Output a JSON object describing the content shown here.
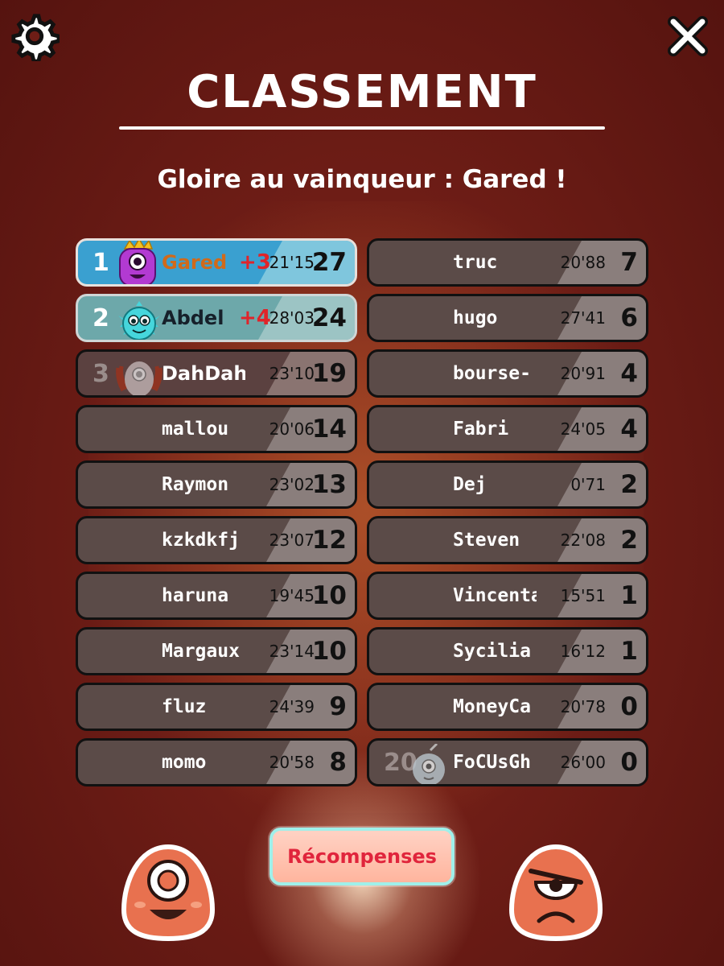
{
  "header": {
    "title": "CLASSEMENT",
    "subtitle": "Gloire au vainqueur :  Gared !"
  },
  "icons": {
    "settings": "gear-icon",
    "close": "close-icon"
  },
  "leaderboard": {
    "left": [
      {
        "rank": "1",
        "name": "Gared",
        "gain": "+3",
        "time": "21'15",
        "score": "27",
        "style": "gold",
        "avatar": "purple-monster"
      },
      {
        "rank": "2",
        "name": "Abdel",
        "gain": "+4",
        "time": "28'03",
        "score": "24",
        "style": "silver",
        "avatar": "teal-monster"
      },
      {
        "rank": "3",
        "name": "DahDah",
        "gain": "",
        "time": "23'10",
        "score": "19",
        "style": "bronze",
        "avatar": "gray-monster"
      },
      {
        "rank": "",
        "name": "mallou",
        "gain": "",
        "time": "20'06",
        "score": "14",
        "style": "normal"
      },
      {
        "rank": "",
        "name": "Raymon",
        "gain": "",
        "time": "23'02",
        "score": "13",
        "style": "normal"
      },
      {
        "rank": "",
        "name": "kzkdkfj",
        "gain": "",
        "time": "23'07",
        "score": "12",
        "style": "normal"
      },
      {
        "rank": "",
        "name": "haruna",
        "gain": "",
        "time": "19'45",
        "score": "10",
        "style": "normal"
      },
      {
        "rank": "",
        "name": "Margaux",
        "gain": "",
        "time": "23'14",
        "score": "10",
        "style": "normal"
      },
      {
        "rank": "",
        "name": "fluz",
        "gain": "",
        "time": "24'39",
        "score": "9",
        "style": "normal"
      },
      {
        "rank": "",
        "name": "momo",
        "gain": "",
        "time": "20'58",
        "score": "8",
        "style": "normal"
      }
    ],
    "right": [
      {
        "rank": "",
        "name": "truc",
        "gain": "",
        "time": "20'88",
        "score": "7",
        "style": "normal"
      },
      {
        "rank": "",
        "name": "hugo",
        "gain": "",
        "time": "27'41",
        "score": "6",
        "style": "normal"
      },
      {
        "rank": "",
        "name": "bourse-",
        "gain": "",
        "time": "20'91",
        "score": "4",
        "style": "normal"
      },
      {
        "rank": "",
        "name": "Fabri",
        "gain": "",
        "time": "24'05",
        "score": "4",
        "style": "normal"
      },
      {
        "rank": "",
        "name": "Dej",
        "gain": "",
        "time": "0'71",
        "score": "2",
        "style": "normal"
      },
      {
        "rank": "",
        "name": "Steven",
        "gain": "",
        "time": "22'08",
        "score": "2",
        "style": "normal"
      },
      {
        "rank": "",
        "name": "Vincenta",
        "gain": "",
        "time": "15'51",
        "score": "1",
        "style": "normal"
      },
      {
        "rank": "",
        "name": "Sycilia",
        "gain": "",
        "time": "16'12",
        "score": "1",
        "style": "normal"
      },
      {
        "rank": "",
        "name": "MoneyCa",
        "gain": "",
        "time": "20'78",
        "score": "0",
        "style": "normal"
      },
      {
        "rank": "20",
        "name": "FoCUsGh",
        "gain": "",
        "time": "26'00",
        "score": "0",
        "style": "normal",
        "avatar": "ghost-monster"
      }
    ]
  },
  "footer": {
    "rewards_label": "Récompenses",
    "left_button": "happy-monster-icon",
    "right_button": "angry-monster-icon"
  },
  "colors": {
    "background": "#6e1d16",
    "gold_row": "#3aa0d0",
    "silver_row": "#6da8aa",
    "gain": "#e0242a",
    "rewards_text": "#e0253c"
  }
}
